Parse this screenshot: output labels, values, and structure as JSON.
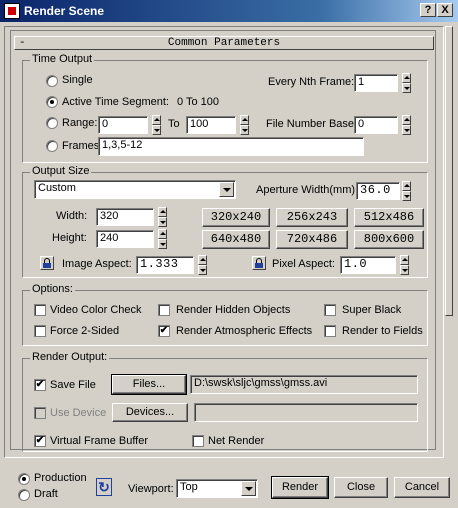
{
  "window": {
    "title": "Render Scene",
    "help_label": "?",
    "close_label": "X"
  },
  "rollout": {
    "minus": "-",
    "title": "Common Parameters"
  },
  "time_output": {
    "label": "Time Output",
    "single_label": "Single",
    "every_nth_label": "Every Nth Frame:",
    "every_nth_value": "1",
    "active_segment_label": "Active Time Segment:",
    "active_segment_value": "0 To 100",
    "range_label": "Range:",
    "range_from": "0",
    "range_to_label": "To",
    "range_to": "100",
    "file_number_base_label": "File Number Base:",
    "file_number_base_value": "0",
    "frames_label": "Frames",
    "frames_value": "1,3,5-12",
    "selected": "active_segment"
  },
  "output_size": {
    "label": "Output Size",
    "preset_value": "Custom",
    "aperture_label": "Aperture Width(mm):",
    "aperture_value": "36.0",
    "width_label": "Width:",
    "width_value": "320",
    "height_label": "Height:",
    "height_value": "240",
    "presets": [
      "320x240",
      "256x243",
      "512x486",
      "640x480",
      "720x486",
      "800x600"
    ],
    "image_aspect_label": "Image Aspect:",
    "image_aspect_value": "1.333",
    "pixel_aspect_label": "Pixel Aspect:",
    "pixel_aspect_value": "1.0"
  },
  "options": {
    "label": "Options:",
    "video_color_check": "Video Color Check",
    "render_hidden_objects": "Render Hidden Objects",
    "super_black": "Super Black",
    "force_2_sided": "Force 2-Sided",
    "render_atmospheric_effects": "Render Atmospheric Effects",
    "render_to_fields": "Render to Fields",
    "checked": [
      "render_atmospheric_effects"
    ]
  },
  "render_output": {
    "label": "Render Output:",
    "save_file_label": "Save File",
    "save_file_checked": true,
    "files_button": "Files...",
    "file_path": "D:\\swsk\\sljc\\gmss\\gmss.avi",
    "use_device_label": "Use Device",
    "devices_button": "Devices...",
    "device_value": "",
    "virtual_frame_buffer_label": "Virtual Frame Buffer",
    "virtual_frame_buffer_checked": true,
    "net_render_label": "Net Render",
    "net_render_checked": false
  },
  "footer": {
    "production_label": "Production",
    "draft_label": "Draft",
    "selected": "production",
    "viewport_label": "Viewport:",
    "viewport_value": "Top",
    "render_button": "Render",
    "close_button": "Close",
    "cancel_button": "Cancel"
  },
  "check_mark": "✔"
}
